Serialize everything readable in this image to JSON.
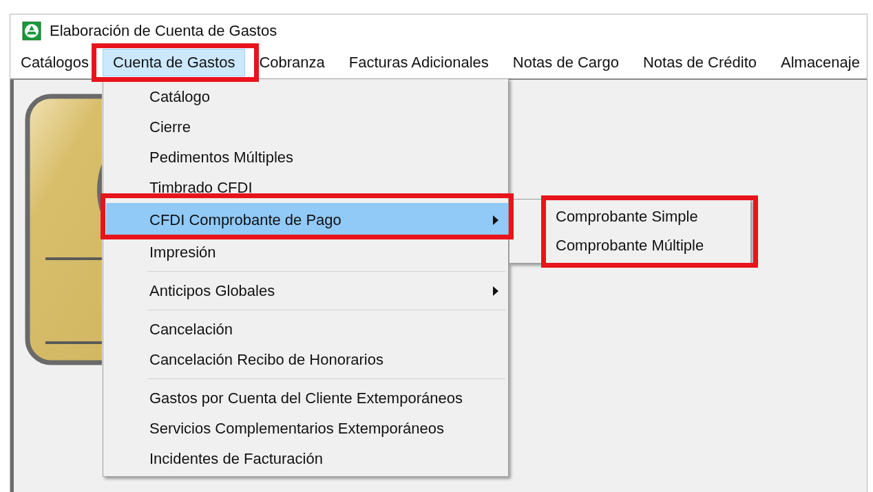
{
  "window": {
    "title": "Elaboración de Cuenta de Gastos"
  },
  "menu_bar": [
    {
      "label": "Catálogos",
      "selected": false
    },
    {
      "label": "Cuenta de Gastos",
      "selected": true
    },
    {
      "label": "Cobranza",
      "selected": false
    },
    {
      "label": "Facturas Adicionales",
      "selected": false
    },
    {
      "label": "Notas de Cargo",
      "selected": false
    },
    {
      "label": "Notas de Crédito",
      "selected": false
    },
    {
      "label": "Almacenaje",
      "selected": false
    }
  ],
  "dropdown": {
    "items": [
      {
        "kind": "item",
        "label": "Catálogo",
        "selected": false
      },
      {
        "kind": "item",
        "label": "Cierre",
        "selected": false
      },
      {
        "kind": "item",
        "label": "Pedimentos Múltiples",
        "selected": false
      },
      {
        "kind": "item",
        "label": "Timbrado CFDI",
        "selected": false
      },
      {
        "kind": "submenu",
        "label": "CFDI Comprobante de Pago",
        "selected": true
      },
      {
        "kind": "item",
        "label": "Impresión",
        "selected": false
      },
      {
        "kind": "separator"
      },
      {
        "kind": "submenu",
        "label": "Anticipos Globales",
        "selected": false
      },
      {
        "kind": "separator"
      },
      {
        "kind": "item",
        "label": "Cancelación",
        "selected": false
      },
      {
        "kind": "item",
        "label": "Cancelación Recibo de Honorarios",
        "selected": false
      },
      {
        "kind": "separator"
      },
      {
        "kind": "item",
        "label": "Gastos por Cuenta del Cliente Extemporáneos",
        "selected": false
      },
      {
        "kind": "item",
        "label": "Servicios Complementarios Extemporáneos",
        "selected": false
      },
      {
        "kind": "item",
        "label": "Incidentes de Facturación",
        "selected": false
      }
    ]
  },
  "submenu": {
    "items": [
      {
        "label": "Comprobante Simple",
        "selected": false
      },
      {
        "label": "Comprobante Múltiple",
        "selected": false
      }
    ]
  }
}
